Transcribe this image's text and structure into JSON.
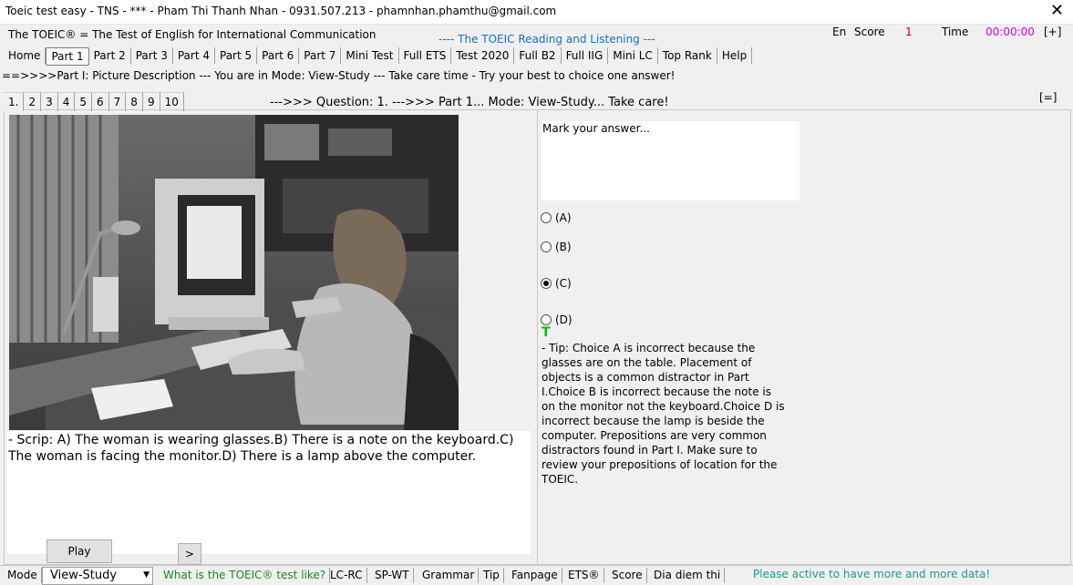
{
  "window": {
    "title": "Toeic test easy - TNS - *** - Pham Thi Thanh Nhan - 0931.507.213 - phamnhan.phamthu@gmail.com",
    "close": "✕"
  },
  "header": {
    "subtitle": "The TOEIC® = The Test of English for International Communication",
    "center_title": "---- The TOEIC Reading and Listening ---",
    "lang": "En",
    "score_label": "Score",
    "score_value": "1",
    "time_label": "Time",
    "time_value": "00:00:00",
    "expand": "[+]"
  },
  "menu": [
    "Home",
    "Part 1",
    "Part 2",
    "Part 3",
    "Part 4",
    "Part 5",
    "Part 6",
    "Part 7",
    "Mini Test",
    "Full ETS",
    "Test 2020",
    "Full B2",
    "Full IIG",
    "Mini LC",
    "Top Rank",
    "Help"
  ],
  "instruction": "==>>>>Part I: Picture Description --- You are in Mode: View-Study --- Take care time - Try your best to choice one answer!",
  "question_tabs": [
    "1.",
    "2",
    "3",
    "4",
    "5",
    "6",
    "7",
    "8",
    "9",
    "10"
  ],
  "question_info": "--->>> Question: 1. --->>> Part 1... Mode: View-Study... Take care!",
  "panel_toggle": "[=]",
  "scrip": "- Scrip: A) The woman is wearing glasses.B) There is a note on the keyboard.C) The woman is facing the monitor.D) There is a lamp above the computer.",
  "play_label": "Play",
  "next_label": ">",
  "answer": {
    "mark_label": "Mark your answer...",
    "options": [
      "(A)",
      "(B)",
      "(C)",
      "(D)"
    ],
    "selected": "(C)",
    "correct_marker": "T",
    "tip": "- Tip: Choice A is incorrect because the glasses are on the table. Placement of objects is a common distractor in Part I.Choice B is incorrect because the note is on the monitor not the keyboard.Choice D is incorrect because the lamp is beside the computer. Prepositions are very common distractors found in Part I. Make sure to review your prepositions of location for the TOEIC."
  },
  "status": {
    "mode_label": "Mode",
    "mode_value": "View-Study",
    "what_link": "What is the TOEIC® test like?",
    "items": [
      "LC-RC",
      "SP-WT",
      "Grammar",
      "Tip",
      "Fanpage",
      "ETS®",
      "Score",
      "Dia diem thi"
    ],
    "notice": "Please active to have more and more data!"
  },
  "colors": {
    "score": "#e00000",
    "time": "#e000e0",
    "center_title": "#1a6fc0",
    "green_link": "#1a8a1a",
    "notice": "#1a9a8a",
    "correct": "#00c000"
  }
}
